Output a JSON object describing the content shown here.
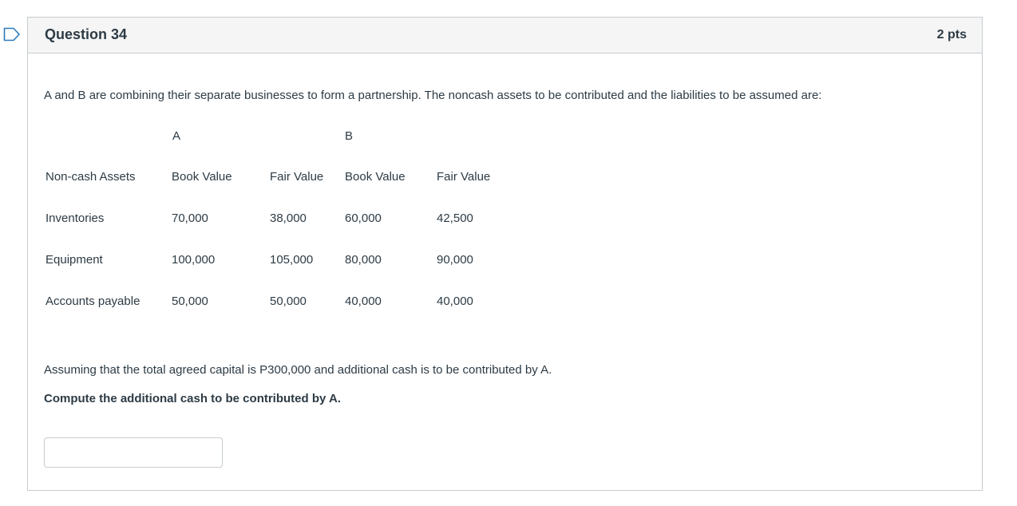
{
  "question": {
    "title": "Question 34",
    "points": "2 pts",
    "prompt": "A and B are combining their separate businesses to form a partnership. The noncash assets to be contributed and the liabilities to be assumed are:",
    "assumption": "Assuming that the total agreed capital is P300,000 and additional cash is to be contributed by A.",
    "instruction": "Compute the additional cash to be contributed by A.",
    "answer_value": ""
  },
  "table": {
    "group_a": "A",
    "group_b": "B",
    "header": [
      "Non-cash Assets",
      "Book Value",
      "Fair Value",
      "Book Value",
      "Fair Value"
    ],
    "rows": [
      [
        "Inventories",
        "70,000",
        "38,000",
        "60,000",
        "42,500"
      ],
      [
        "Equipment",
        "100,000",
        "105,000",
        "80,000",
        "90,000"
      ],
      [
        "Accounts payable",
        "50,000",
        "50,000",
        "40,000",
        "40,000"
      ]
    ]
  },
  "colors": {
    "flag_outline": "#2b7abc",
    "header_bg": "#f5f5f5",
    "border": "#c7cdd1",
    "text": "#2d3b45"
  },
  "icons": {
    "flag": "bookmark-flag-icon"
  }
}
